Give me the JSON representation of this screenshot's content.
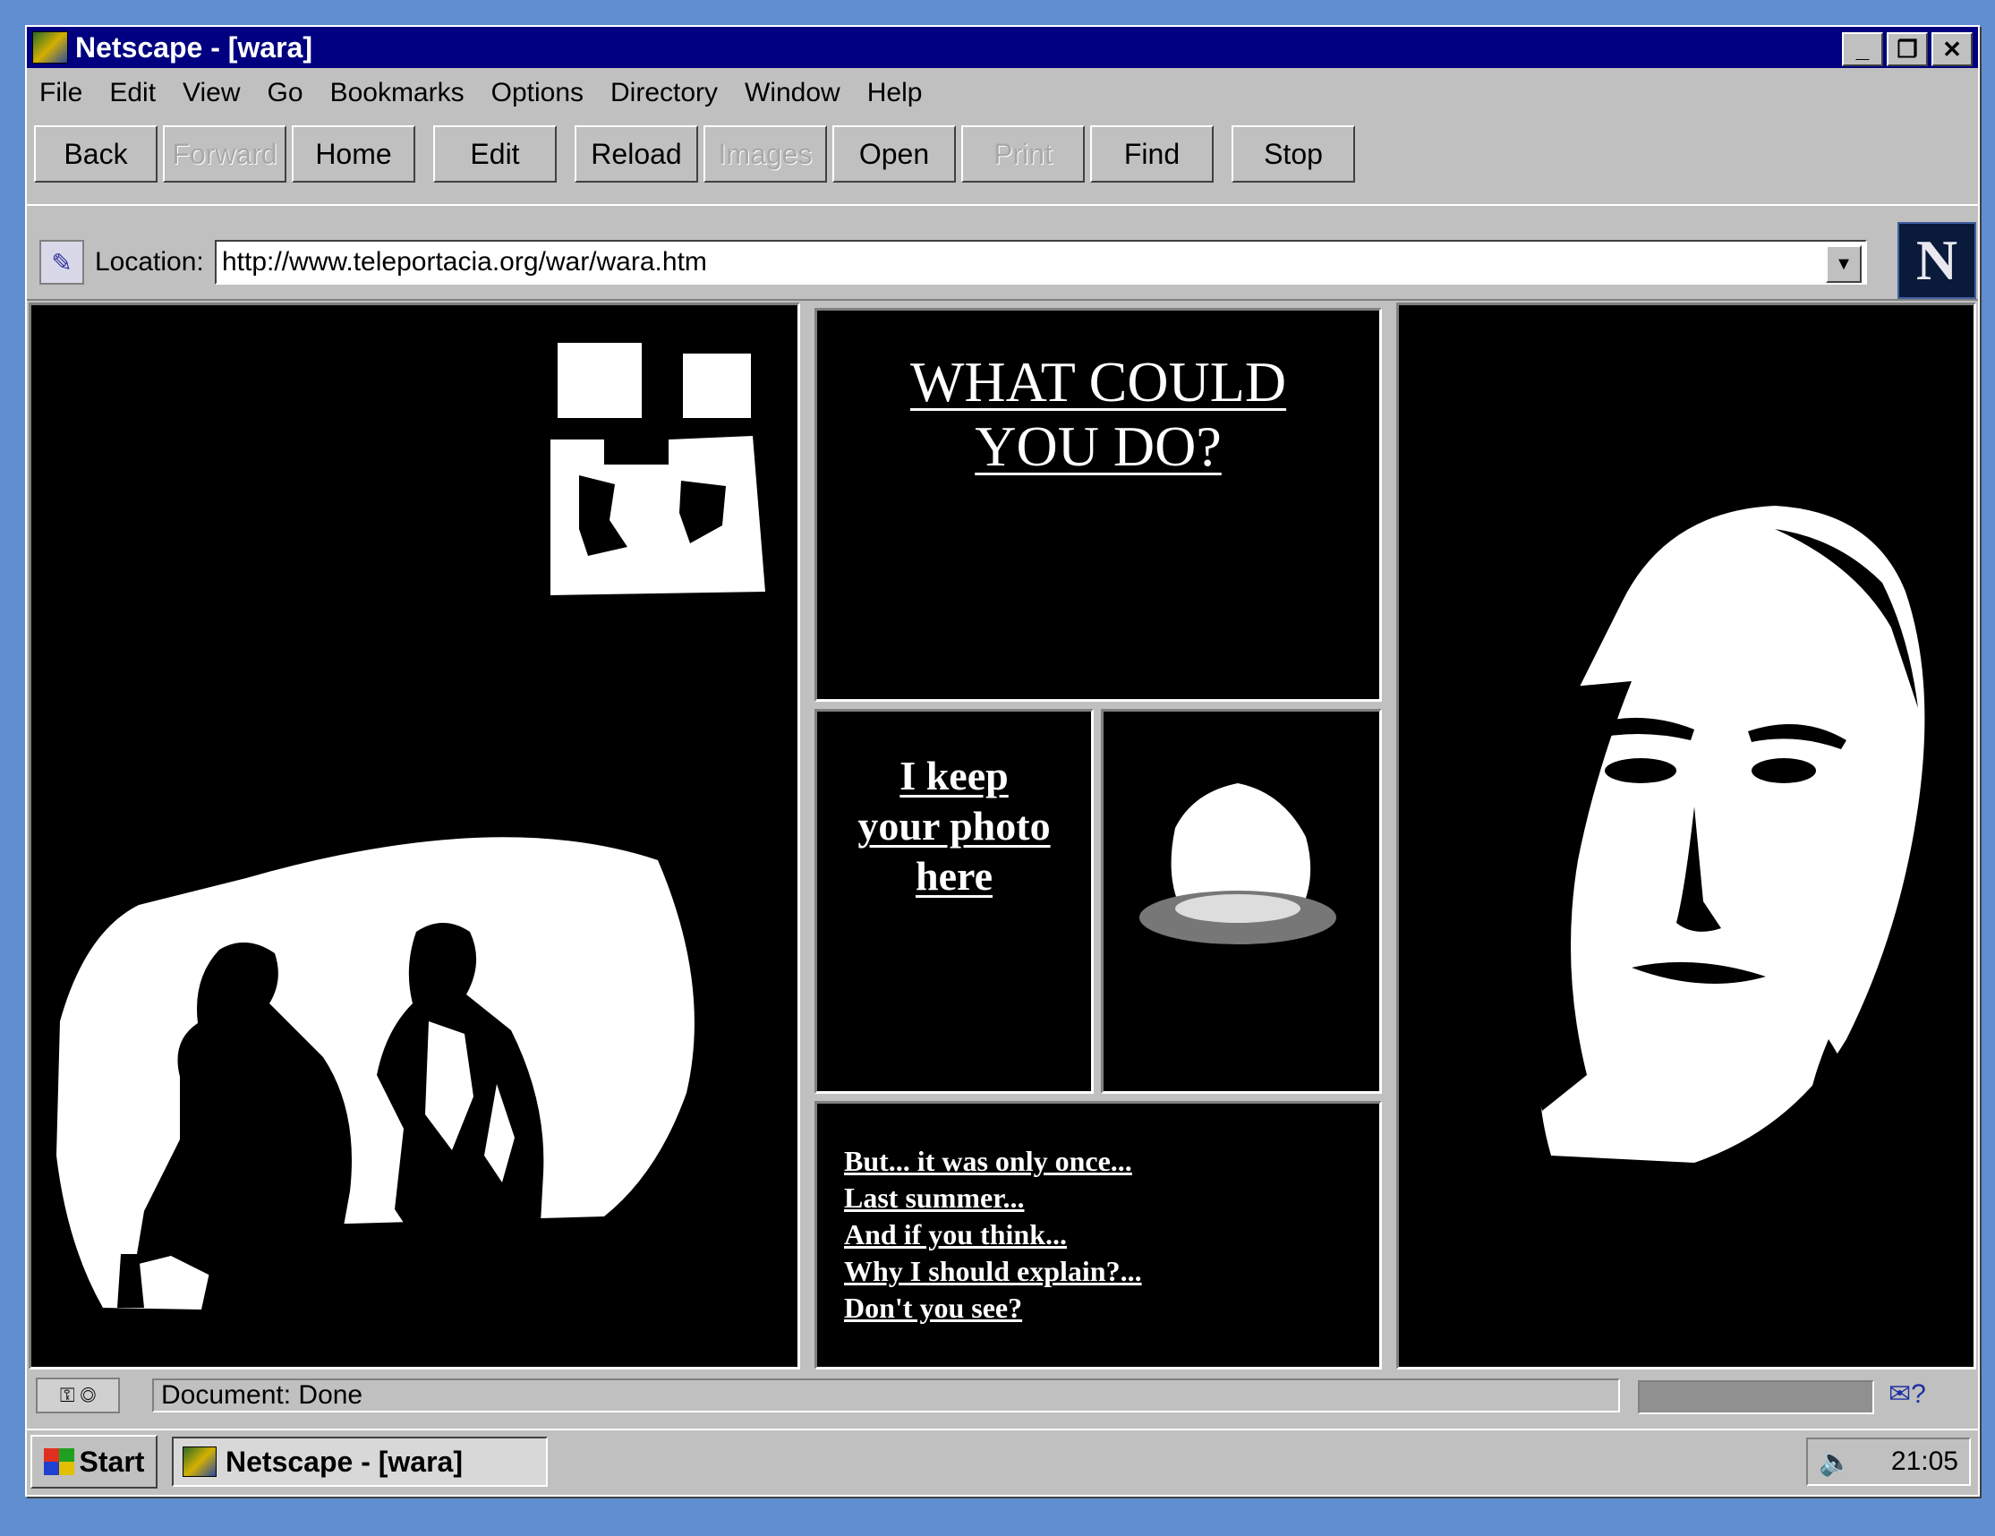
{
  "window": {
    "title": "Netscape - [wara]",
    "controls": [
      "_",
      "❐",
      "✕"
    ]
  },
  "menu": [
    "File",
    "Edit",
    "View",
    "Go",
    "Bookmarks",
    "Options",
    "Directory",
    "Window",
    "Help"
  ],
  "toolbar": {
    "back": "Back",
    "forward": "Forward",
    "home": "Home",
    "edit": "Edit",
    "reload": "Reload",
    "images": "Images",
    "open": "Open",
    "print": "Print",
    "find": "Find",
    "stop": "Stop"
  },
  "location": {
    "label": "Location:",
    "url": "http://www.teleportacia.org/war/wara.htm",
    "logo": "N"
  },
  "page": {
    "heading_line1": "WHAT COULD",
    "heading_line2": "YOU DO?",
    "photo_link_line1": "I keep",
    "photo_link_line2": "your photo",
    "photo_link_line3": "here",
    "links": [
      "But... it was only once...",
      "Last summer...",
      "And if you think...",
      "Why I should explain?...",
      "Don't you see?"
    ]
  },
  "status": {
    "text": "Document: Done",
    "mail_icon": "mail-icon"
  },
  "taskbar": {
    "start": "Start",
    "task": "Netscape - [wara]",
    "clock": "21:05"
  }
}
